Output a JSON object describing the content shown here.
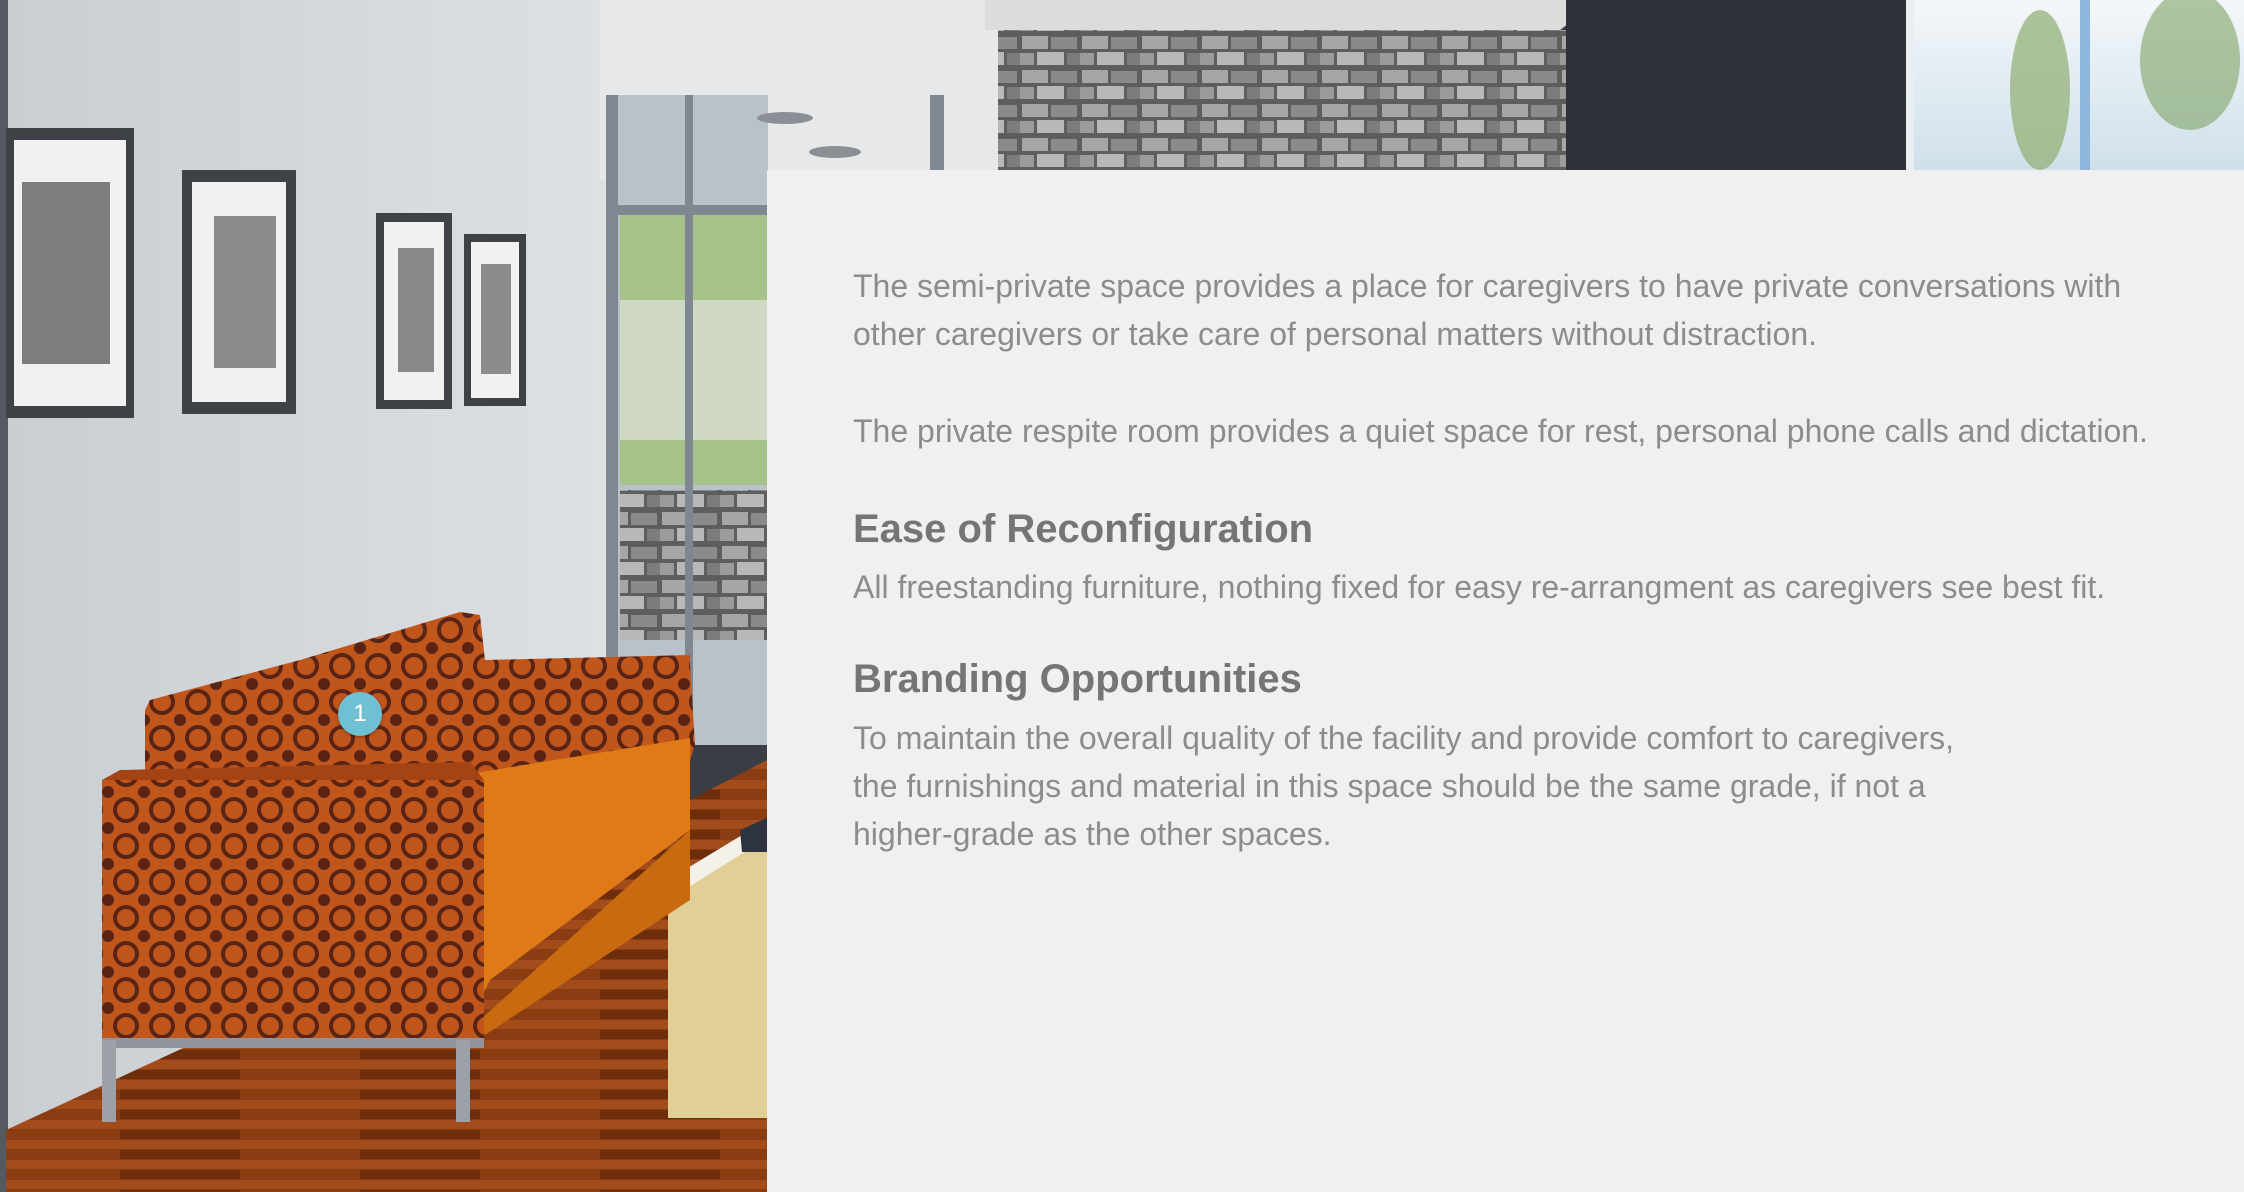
{
  "hotspot": {
    "label": "1"
  },
  "content": {
    "paragraph_semi_private": "The semi-private space provides a place for caregivers to have private conversations with other caregivers or take care of personal matters without distraction.",
    "paragraph_private_respite": "The private respite room provides a quiet space for rest, personal phone calls and dictation.",
    "heading_reconfiguration": "Ease of Reconfiguration",
    "paragraph_reconfiguration": "All freestanding furniture, nothing fixed for easy re-arrangment as caregivers see best fit.",
    "heading_branding": "Branding Opportunities",
    "paragraph_branding": "To maintain the overall quality of the facility and provide comfort to caregivers, the furnishings and material in this space should be the same grade, if not a higher-grade as the other spaces."
  },
  "colors": {
    "panel_background": "#f0f0f0",
    "body_text": "#8c8c8c",
    "heading_text": "#757575",
    "hotspot": "#6fc0d2",
    "sofa_orange": "#e07a16"
  },
  "icons": {
    "hotspot_marker": "numbered-hotspot-icon"
  }
}
